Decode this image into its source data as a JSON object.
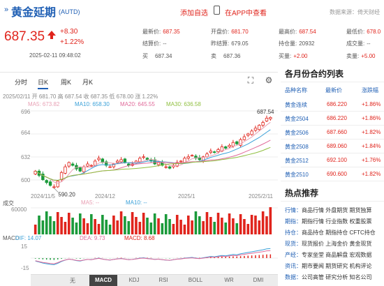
{
  "header": {
    "arrows": "»",
    "name": "黄金延期",
    "code": "(AUTD)",
    "add_watch": "添加自选",
    "app_view": "在APP中查看",
    "source": "数据来源：倚天财经"
  },
  "price": {
    "last": "687.35",
    "change": "+8.30",
    "change_pct": "+1.22%",
    "datetime": "2025-02-11 09:48:02"
  },
  "quote": {
    "latest": {
      "label": "最新价:",
      "value": "687.35"
    },
    "settle": {
      "label": "结算价:",
      "value": "--"
    },
    "buy": {
      "label": "买",
      "value": "687.34"
    },
    "open": {
      "label": "开盘价:",
      "value": "681.70"
    },
    "prev_settle": {
      "label": "昨结算:",
      "value": "679.05"
    },
    "sell": {
      "label": "卖",
      "value": "687.36"
    },
    "high": {
      "label": "最高价:",
      "value": "687.54"
    },
    "position": {
      "label": "持仓量:",
      "value": "20932"
    },
    "pos_chg": {
      "label": "买量:",
      "value": "+2.00"
    },
    "low": {
      "label": "最低价:",
      "value": "678.0"
    },
    "volume": {
      "label": "成交量:",
      "value": "--"
    },
    "sell_vol": {
      "label": "卖量:",
      "value": "+5.00"
    }
  },
  "chart_tabs": [
    "分时",
    "日K",
    "周K",
    "月K"
  ],
  "ohlc_line": "2025/02/11 开 681.70 高 687.54 收 687.35 低 678.00 涨 1.22%",
  "ma": {
    "ma5": "MA5: 673.82",
    "ma10": "MA10: 658.30",
    "ma20": "MA20: 645.55",
    "ma30": "MA30: 636.58"
  },
  "y_ticks": [
    "696",
    "664",
    "632",
    "600"
  ],
  "x_ticks": [
    "2024/11/5",
    "2024/12",
    "2025/1",
    "2025/2/11"
  ],
  "annot": {
    "high": "687.54",
    "low": "590.20"
  },
  "vol_labels": {
    "title": "成交",
    "ma5": "MA5: --",
    "ma10": "MA10: --",
    "tick": "60000"
  },
  "macd_labels": {
    "title": "MACD",
    "dif": "DIF: 14.07",
    "dea": "DEA: 9.73",
    "macd": "MACD: 8.68",
    "t1": "15",
    "t2": "-15"
  },
  "indicators": [
    "无",
    "MACD",
    "KDJ",
    "RSI",
    "BOLL",
    "WR",
    "DMI"
  ],
  "contracts": {
    "title": "各月份合约列表",
    "headers": [
      "品种名称",
      "最新价",
      "涨跌幅"
    ],
    "rows": [
      {
        "name": "黄金连续",
        "price": "686.220",
        "pct": "+1.86%"
      },
      {
        "name": "黄金2504",
        "price": "686.220",
        "pct": "+1.86%"
      },
      {
        "name": "黄金2506",
        "price": "687.660",
        "pct": "+1.82%"
      },
      {
        "name": "黄金2508",
        "price": "689.060",
        "pct": "+1.84%"
      },
      {
        "name": "黄金2512",
        "price": "692.100",
        "pct": "+1.76%"
      },
      {
        "name": "黄金2510",
        "price": "690.600",
        "pct": "+1.82%"
      }
    ]
  },
  "hot": {
    "title": "热点推荐",
    "rows": [
      {
        "k": "行情：",
        "t": "商品行情 外盘期货 期货独算"
      },
      {
        "k": "期指：",
        "t": "期指行情 行业指数 权重股票"
      },
      {
        "k": "持仓：",
        "t": "商品持仓 期指持仓 CFTC持仓"
      },
      {
        "k": "现货：",
        "t": "现货报价 上海金价 黄金现货"
      },
      {
        "k": "产经：",
        "t": "专家坐堂 商品解盘 宏观数据"
      },
      {
        "k": "资讯：",
        "t": "期市要闻 期货研究 机构评论"
      },
      {
        "k": "数据：",
        "t": "公司高管 研究分析 知名公司"
      }
    ]
  },
  "colors": {
    "up": "#e0241c",
    "down": "#1a9a3a",
    "ma5": "#e8a0b4",
    "ma10": "#3aa0d8",
    "ma20": "#e06a9a",
    "ma30": "#8fbf3f",
    "accent": "#1f5fb4"
  },
  "chart_data": [
    {
      "type": "candlestick",
      "title": "",
      "x_range": [
        "2024/11/5",
        "2025/2/11"
      ],
      "ylim": [
        585,
        700
      ],
      "last_close": 687.35,
      "high_annotation": 687.54,
      "low_annotation": 590.2,
      "closes": [
        612,
        606,
        600,
        596,
        592,
        590,
        598,
        610,
        618,
        624,
        620,
        615,
        612,
        618,
        622,
        620,
        626,
        630,
        624,
        620,
        618,
        622,
        626,
        628,
        624,
        620,
        622,
        626,
        630,
        632,
        628,
        626,
        622,
        624,
        620,
        618,
        616,
        620,
        624,
        626,
        630,
        632,
        634,
        630,
        628,
        632,
        636,
        640,
        638,
        642,
        646,
        644,
        648,
        652,
        650,
        656,
        660,
        664,
        668,
        672,
        676,
        680,
        686,
        687
      ]
    },
    {
      "type": "bar",
      "title": "",
      "ylim": [
        0,
        70000
      ]
    },
    {
      "type": "bar",
      "title": "",
      "ylim": [
        -18,
        18
      ],
      "dif": 14.07,
      "dea": 9.73,
      "macd": 8.68
    }
  ]
}
